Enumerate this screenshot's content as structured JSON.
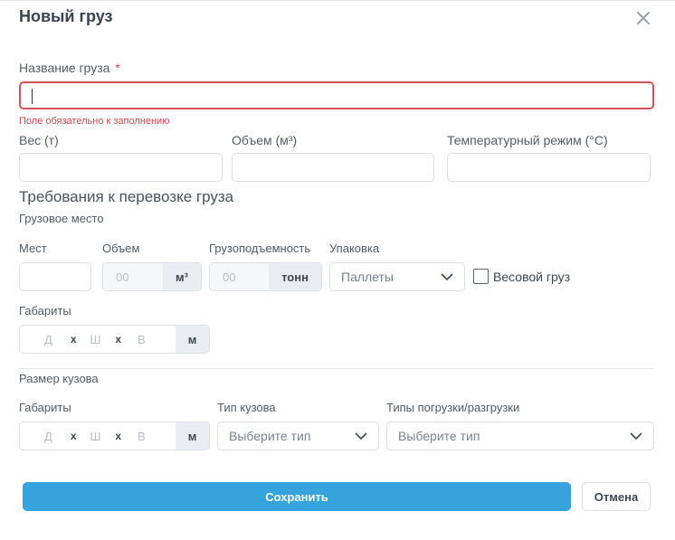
{
  "dialog": {
    "title": "Новый груз",
    "close_icon": "close-icon"
  },
  "cargo_name": {
    "label": "Название груза",
    "required_mark": "*",
    "value": "",
    "error": "Поле обязательно к заполнению"
  },
  "weight": {
    "label": "Вес (т)",
    "value": ""
  },
  "volume": {
    "label": "Объем (м³)",
    "value": ""
  },
  "temperature": {
    "label": "Температурный режим (°С)",
    "value": ""
  },
  "requirements": {
    "title": "Требования к перевозке груза",
    "cargo_place": {
      "subtitle": "Грузовое место",
      "places_label": "Мест",
      "volume_label": "Объем",
      "volume_placeholder": "00",
      "volume_unit": "м³",
      "capacity_label": "Грузоподъемность",
      "capacity_placeholder": "00",
      "capacity_unit": "тонн",
      "packaging_label": "Упаковка",
      "packaging_value": "Паллеты",
      "weight_cargo_label": "Весовой груз",
      "dimensions_label": "Габариты",
      "dim_length": "Д",
      "dim_width": "Ш",
      "dim_height": "В",
      "dim_sep": "x",
      "dim_unit": "м"
    },
    "body_size": {
      "subtitle": "Размер кузова",
      "dimensions_label": "Габариты",
      "dim_length": "Д",
      "dim_width": "Ш",
      "dim_height": "В",
      "dim_sep": "x",
      "dim_unit": "м",
      "body_type_label": "Тип кузова",
      "body_type_placeholder": "Выберите тип",
      "loading_label": "Типы погрузки/разгрузки",
      "loading_placeholder": "Выберите тип"
    }
  },
  "actions": {
    "save": "Сохранить",
    "cancel": "Отмена"
  }
}
